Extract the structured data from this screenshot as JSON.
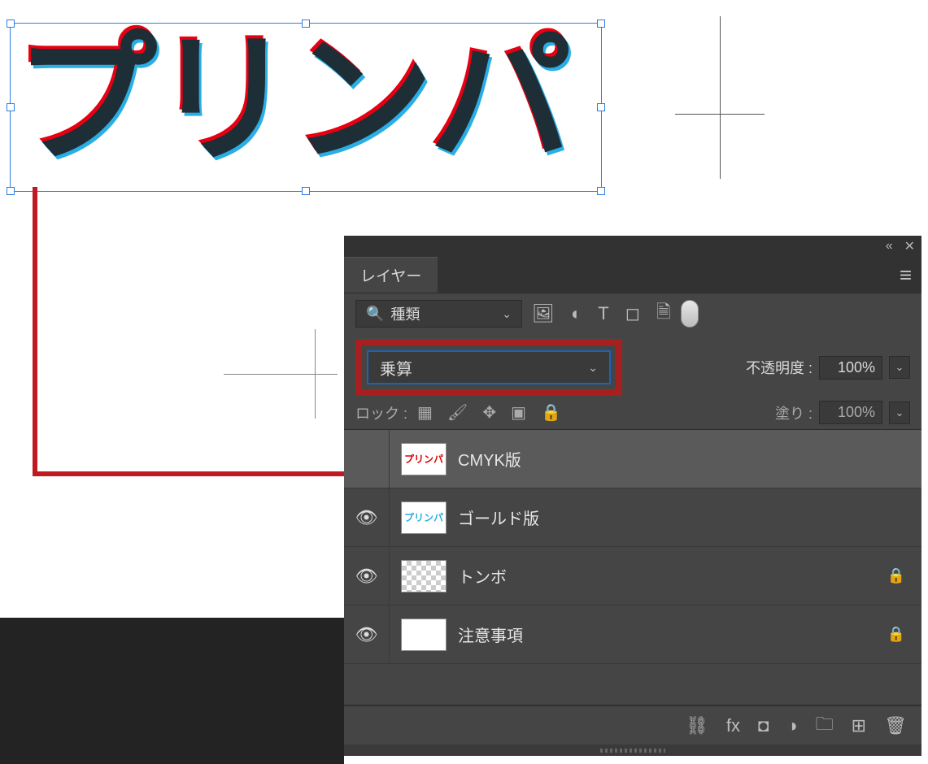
{
  "canvas": {
    "artwork_text": "プリンパ",
    "colors": {
      "cyan": "#2aaee6",
      "red": "#e60012",
      "dark": "#1e2e36"
    }
  },
  "panel": {
    "title": "レイヤー",
    "filter_label": "種類",
    "blend_mode": "乗算",
    "opacity_label": "不透明度 :",
    "opacity_value": "100%",
    "lock_label": "ロック :",
    "fill_label": "塗り :",
    "fill_value": "100%",
    "highlight_color": "#a6201f"
  },
  "layers": [
    {
      "name": "CMYK版",
      "visible": false,
      "selected": true,
      "locked": false,
      "thumb": "red"
    },
    {
      "name": "ゴールド版",
      "visible": true,
      "selected": false,
      "locked": false,
      "thumb": "blue"
    },
    {
      "name": "トンボ",
      "visible": true,
      "selected": false,
      "locked": true,
      "thumb": "checker"
    },
    {
      "name": "注意事項",
      "visible": true,
      "selected": false,
      "locked": true,
      "thumb": "white"
    }
  ],
  "icons": {
    "collapse": "«",
    "close": "✕",
    "menu": "≡",
    "search": "🔍",
    "chevron_down": "⌄",
    "image": "🖼",
    "adjust": "◐",
    "type": "T",
    "shape": "◻",
    "smart": "🗎",
    "eye": "👁",
    "transparency": "▦",
    "brush": "🖌",
    "move": "✥",
    "artboard": "▣",
    "lock": "🔒",
    "link": "⛓",
    "fx": "fx",
    "mask": "◘",
    "fill_adj": "◑",
    "folder": "🗀",
    "new": "⊞",
    "trash": "🗑"
  }
}
